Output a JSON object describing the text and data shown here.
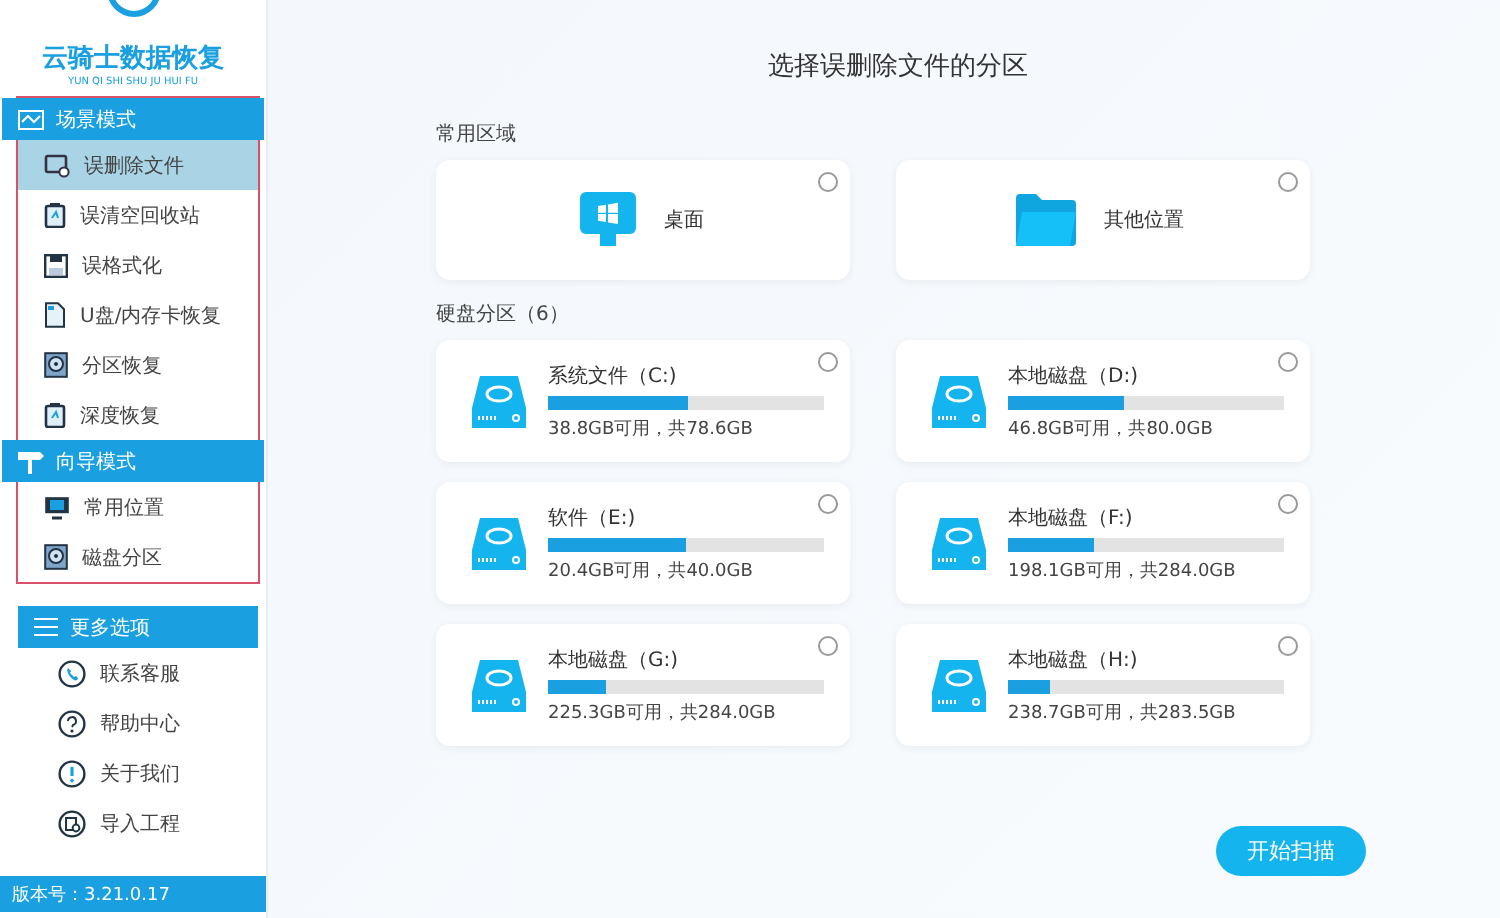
{
  "app": {
    "title": "云骑士数据恢复",
    "subtitle": "YUN QI SHI SHU JU HUI FU"
  },
  "sidebar": {
    "sections": [
      {
        "title": "场景模式",
        "kind": "wave",
        "outlined": true,
        "items": [
          {
            "label": "误删除文件",
            "kind": "file",
            "selected": true
          },
          {
            "label": "误清空回收站",
            "kind": "bin",
            "selected": false
          },
          {
            "label": "误格式化",
            "kind": "floppy",
            "selected": false
          },
          {
            "label": "U盘/内存卡恢复",
            "kind": "card",
            "selected": false
          },
          {
            "label": "分区恢复",
            "kind": "disk",
            "selected": false
          },
          {
            "label": "深度恢复",
            "kind": "bin",
            "selected": false
          }
        ]
      },
      {
        "title": "向导模式",
        "kind": "sign",
        "outlined": true,
        "items": [
          {
            "label": "常用位置",
            "kind": "monitor",
            "selected": false
          },
          {
            "label": "磁盘分区",
            "kind": "disk",
            "selected": false
          }
        ]
      },
      {
        "title": "更多选项",
        "kind": "menu",
        "outlined": false,
        "items": [
          {
            "label": "联系客服",
            "kind": "phone",
            "selected": false
          },
          {
            "label": "帮助中心",
            "kind": "help",
            "selected": false
          },
          {
            "label": "关于我们",
            "kind": "info",
            "selected": false
          },
          {
            "label": "导入工程",
            "kind": "import",
            "selected": false
          }
        ]
      }
    ],
    "version": "版本号：3.21.0.17"
  },
  "main": {
    "title": "选择误删除文件的分区",
    "common_title": "常用区域",
    "locations": [
      {
        "label": "桌面",
        "kind": "desktop",
        "selected": false
      },
      {
        "label": "其他位置",
        "kind": "folder",
        "selected": false
      }
    ],
    "disks_title": "硬盘分区（6）",
    "disks": [
      {
        "name": "系统文件（C:)",
        "level": 0.51,
        "usage": "38.8GB可用，共78.6GB",
        "selected": false
      },
      {
        "name": "本地磁盘（D:)",
        "level": 0.42,
        "usage": "46.8GB可用，共80.0GB",
        "selected": false
      },
      {
        "name": "软件（E:)",
        "level": 0.5,
        "usage": "20.4GB可用，共40.0GB",
        "selected": false
      },
      {
        "name": "本地磁盘（F:)",
        "level": 0.31,
        "usage": "198.1GB可用，共284.0GB",
        "selected": false
      },
      {
        "name": "本地磁盘（G:)",
        "level": 0.21,
        "usage": "225.3GB可用，共284.0GB",
        "selected": false
      },
      {
        "name": "本地磁盘（H:)",
        "level": 0.155,
        "usage": "238.7GB可用，共283.5GB",
        "selected": false
      }
    ],
    "scan_button": "开始扫描"
  }
}
